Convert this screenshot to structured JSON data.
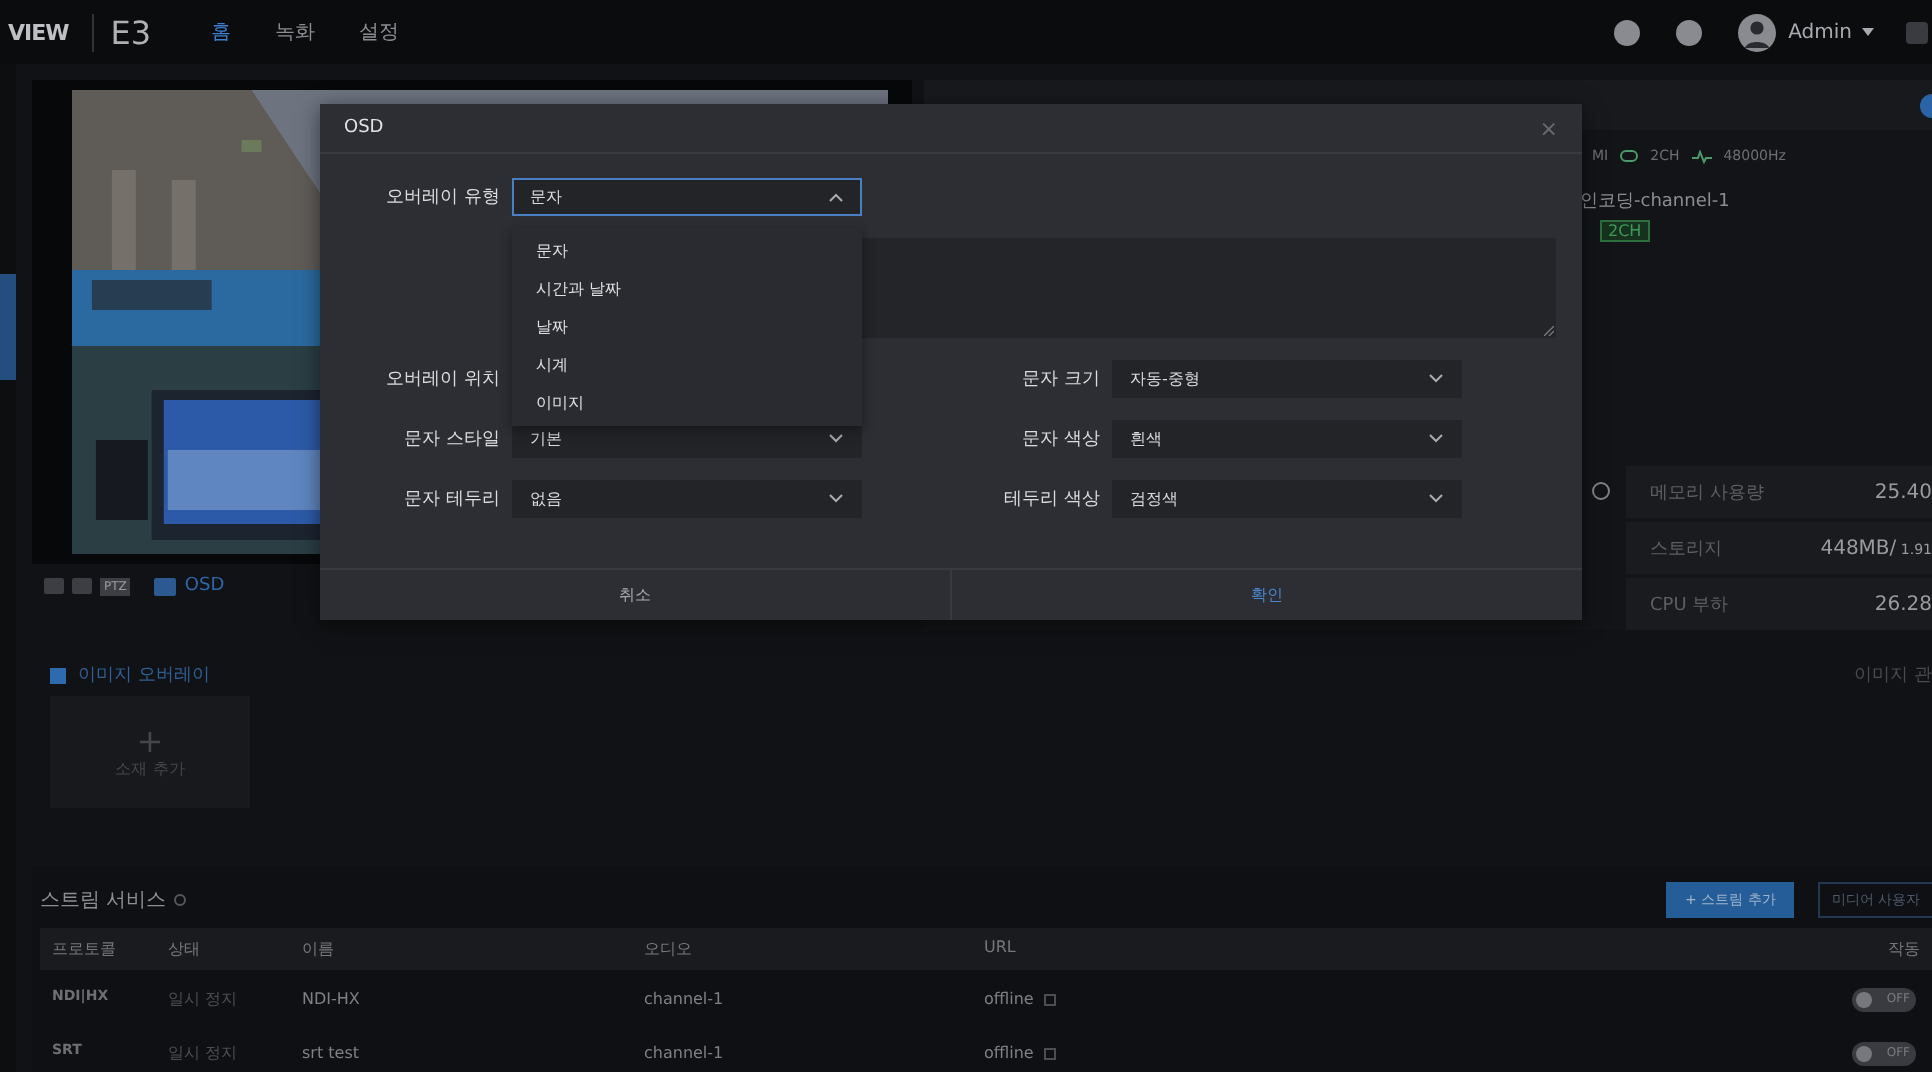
{
  "header": {
    "logo": "VIEW",
    "product": "E3",
    "nav": [
      {
        "label": "홈",
        "selected": true
      },
      {
        "label": "녹화",
        "selected": false
      },
      {
        "label": "설정",
        "selected": false
      }
    ],
    "user": "Admin"
  },
  "audio_info": {
    "source": "MI",
    "channels": "2CH",
    "sample_rate": "48000Hz"
  },
  "encoder": {
    "name": "인코딩-channel-1",
    "badge": "2CH"
  },
  "stats": [
    {
      "label": "메모리 사용량",
      "value": "25.40"
    },
    {
      "label": "스토리지",
      "value": "448MB/",
      "sub": "1.91"
    },
    {
      "label": "CPU 부하",
      "value": "26.28"
    }
  ],
  "video_toolbar": {
    "ptz_label": "PTZ",
    "osd_label": "OSD"
  },
  "image_overlay": {
    "label": "이미지 오버레이",
    "checked": true,
    "add_icon": "+",
    "add_label": "소재 추가",
    "manage_link": "이미지 관"
  },
  "stream_service": {
    "title": "스트림 서비스",
    "add_button": "+ 스트림 추가",
    "media_button": "미디어 사용자",
    "columns": [
      "프로토콜",
      "상태",
      "이름",
      "오디오",
      "URL",
      "작동"
    ],
    "rows": [
      {
        "protocol": "NDI|HX",
        "status": "일시 정지",
        "name": "NDI-HX",
        "audio": "channel-1",
        "url": "offline",
        "on": false,
        "toggle_label": "OFF"
      },
      {
        "protocol": "SRT",
        "status": "일시 정지",
        "name": "srt test",
        "audio": "channel-1",
        "url": "offline",
        "on": false,
        "toggle_label": "OFF"
      }
    ]
  },
  "dialog": {
    "title": "OSD",
    "close": "×",
    "type_select": {
      "label": "오버레이 유형",
      "value": "문자",
      "open": true,
      "options": [
        "문자",
        "시간과 날짜",
        "날짜",
        "시계",
        "이미지"
      ]
    },
    "rows": [
      {
        "left": {
          "label": "오버레이 위치"
        },
        "right": {
          "label": "문자 크기",
          "value": "자동-중형"
        }
      },
      {
        "left": {
          "label": "문자 스타일",
          "value": "기본"
        },
        "right": {
          "label": "문자 색상",
          "value": "흰색"
        }
      },
      {
        "left": {
          "label": "문자 테두리",
          "value": "없음"
        },
        "right": {
          "label": "테두리 색상",
          "value": "검정색"
        }
      }
    ],
    "cancel": "취소",
    "confirm": "확인"
  }
}
